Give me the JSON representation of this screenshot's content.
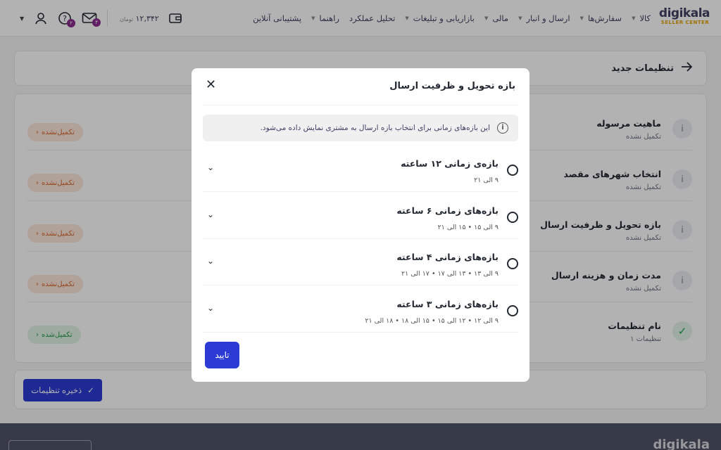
{
  "header": {
    "logo": {
      "name": "digikala",
      "sub": "SELLER CENTER"
    },
    "nav": [
      {
        "label": "کالا",
        "caret": true
      },
      {
        "label": "سفارش‌ها",
        "caret": true
      },
      {
        "label": "ارسال و انبار",
        "caret": true
      },
      {
        "label": "مالی",
        "caret": true
      },
      {
        "label": "بازاریابی و تبلیغات",
        "caret": true
      },
      {
        "label": "تحلیل عملکرد",
        "caret": false
      },
      {
        "label": "راهنما",
        "caret": true
      },
      {
        "label": "پشتیبانی آنلاین",
        "caret": false
      }
    ],
    "help_badge": "۲",
    "mail_badge": "۴",
    "wallet_amount": "۱۲,۳۴۲",
    "wallet_unit": "تومان"
  },
  "page": {
    "title": "تنظیمات جدید",
    "rows": [
      {
        "title": "ماهیت مرسوله",
        "subtitle": "تکمیل نشده",
        "status": "تکمیل‌نشده",
        "done": false
      },
      {
        "title": "انتخاب شهرهای مقصد",
        "subtitle": "تکمیل نشده",
        "status": "تکمیل‌نشده",
        "done": false
      },
      {
        "title": "بازه تحویل و ظرفیت ارسال",
        "subtitle": "تکمیل نشده",
        "status": "تکمیل‌نشده",
        "done": false
      },
      {
        "title": "مدت زمان و هزینه ارسال",
        "subtitle": "تکمیل نشده",
        "status": "تکمیل‌نشده",
        "done": false
      },
      {
        "title": "نام تنظیمات",
        "subtitle": "تنظیمات ۱",
        "status": "تکمیل‌شده",
        "done": true
      }
    ],
    "save_label": "ذخیره تنظیمات"
  },
  "footer": {
    "logo": "digikala"
  },
  "modal": {
    "title": "بازه تحویل و ظرفیت ارسال",
    "info": "این بازه‌های زمانی برای انتخاب بازه ارسال به مشتری نمایش داده می‌شود.",
    "options": [
      {
        "title": "بازه‌ی زمانی ۱۲ ساعته",
        "values": "۹ الی ۲۱"
      },
      {
        "title": "بازه‌های زمانی ۶ ساعته",
        "values": "۹ الی ۱۵  •  ۱۵ الی ۲۱"
      },
      {
        "title": "بازه‌های زمانی ۴ ساعته",
        "values": "۹ الی ۱۳  •  ۱۳ الی ۱۷  •  ۱۷ الی ۲۱"
      },
      {
        "title": "بازه‌های زمانی ۳ ساعته",
        "values": "۹ الی ۱۲  •  ۱۲ الی ۱۵  •  ۱۵ الی ۱۸  •  ۱۸ الی ۲۱"
      }
    ],
    "confirm_label": "تایید"
  }
}
